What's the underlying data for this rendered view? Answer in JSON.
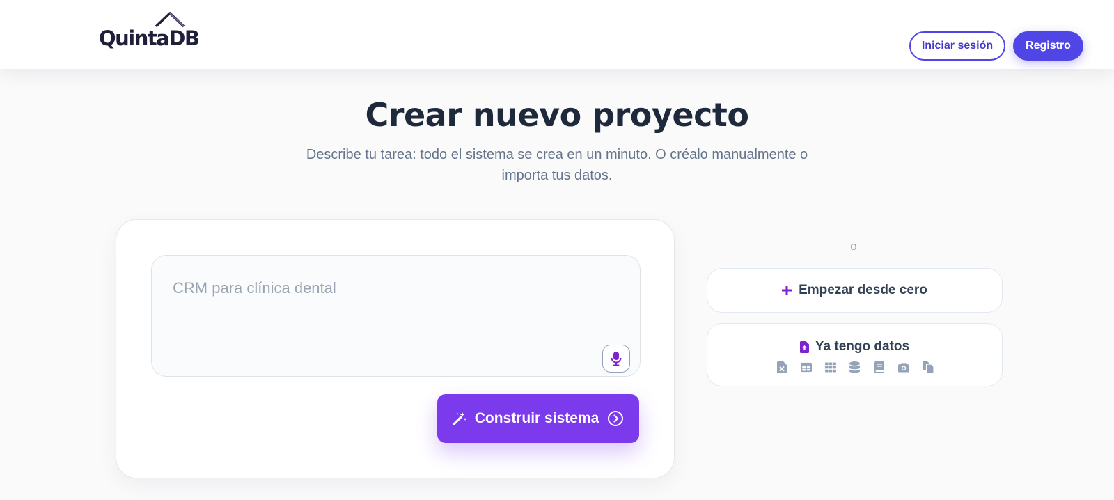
{
  "header": {
    "logo_text": "QuintaDB",
    "login_label": "Iniciar sesión",
    "register_label": "Registro"
  },
  "hero": {
    "title": "Crear nuevo proyecto",
    "subtitle": "Describe tu tarea: todo el sistema se crea en un minuto. O créalo manualmente o importa tus datos."
  },
  "prompt": {
    "placeholder": "CRM para clínica dental",
    "value": "",
    "mic_icon": "microphone-icon"
  },
  "build_button": {
    "label": "Construir sistema",
    "left_icon": "magic-wand-icon",
    "right_icon": "arrow-circle-right-icon"
  },
  "options": {
    "divider_text": "o",
    "scratch": {
      "label": "Empezar desde cero",
      "icon": "plus-icon"
    },
    "data": {
      "label": "Ya tengo datos",
      "icon": "file-upload-icon",
      "sources": [
        "excel-file-icon",
        "table-icon",
        "grid-icon",
        "database-icon",
        "book-icon",
        "camera-icon",
        "copy-files-icon"
      ]
    }
  },
  "colors": {
    "primary": "#4f46e5",
    "accent": "#7c3aed",
    "icon_purple": "#7e22ce",
    "heading": "#1e293b",
    "muted": "#64748b",
    "icon_gray": "#94a3b8"
  }
}
